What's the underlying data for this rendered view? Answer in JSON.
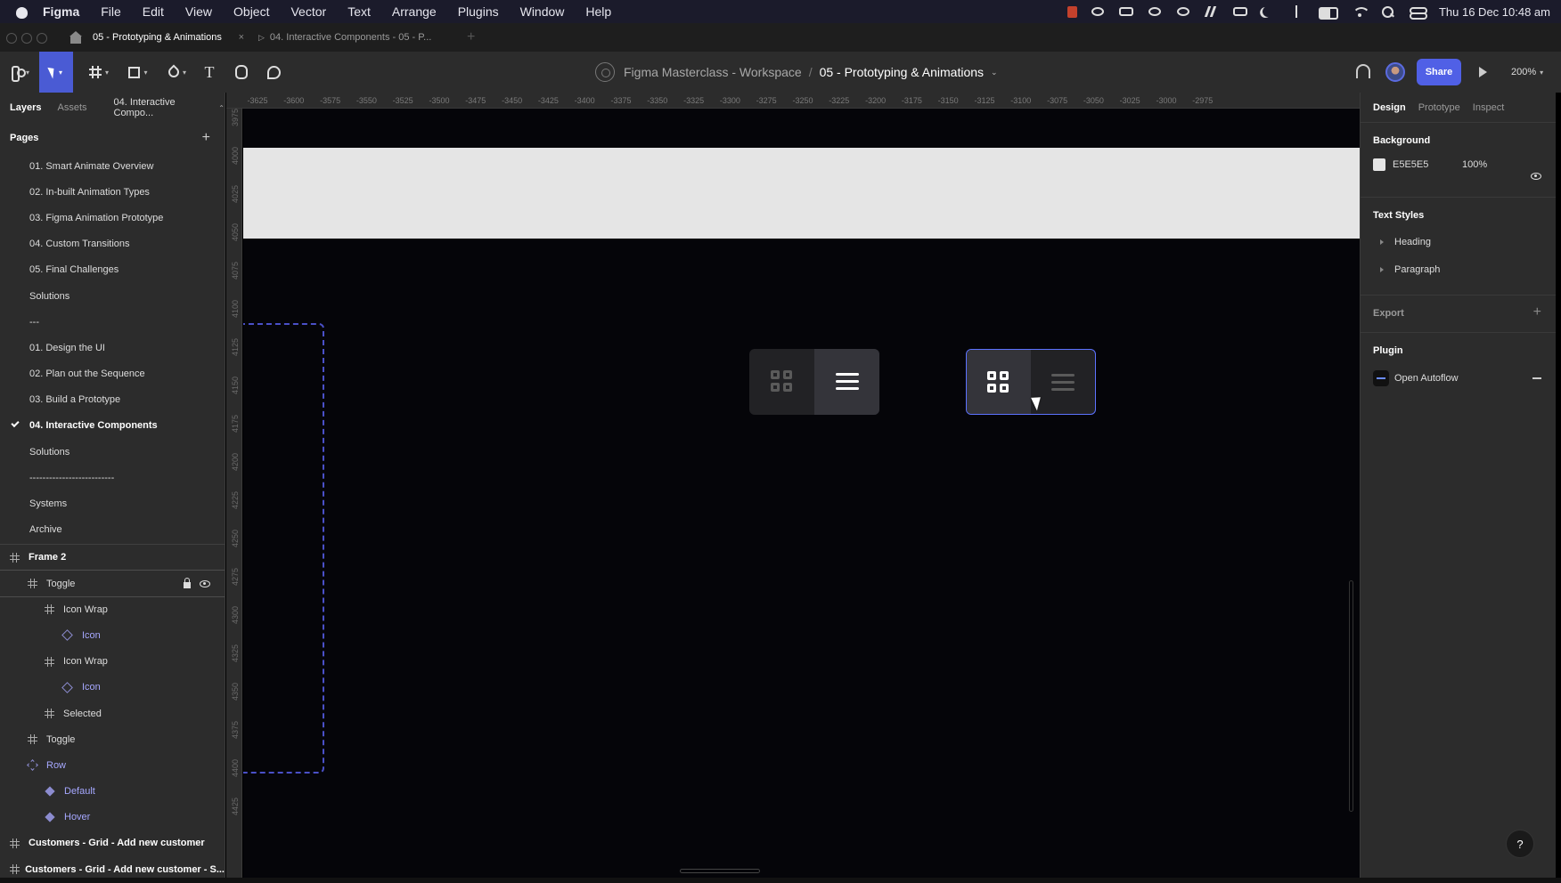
{
  "menubar": {
    "app_name": "Figma",
    "items": [
      "File",
      "Edit",
      "View",
      "Object",
      "Vector",
      "Text",
      "Arrange",
      "Plugins",
      "Window",
      "Help"
    ],
    "clock": "Thu 16 Dec  10:48 am",
    "status_icons": [
      "record-icon",
      "gear-icon",
      "screen-mirror-icon",
      "cloud-icon",
      "circle-icon",
      "bars-icon",
      "shield-icon",
      "moon-icon",
      "bluetooth-icon",
      "battery-icon",
      "wifi-icon",
      "spotlight-search-icon",
      "control-center-icon"
    ]
  },
  "tabs": {
    "active": "05 - Prototyping & Animations",
    "close_glyph": "×",
    "play_glyph": "▷",
    "inactive": "04. Interactive Components - 05 - P...",
    "new_tab_glyph": "+"
  },
  "toolbar": {
    "workspace": "Figma Masterclass - Workspace",
    "separator": "/",
    "file_name": "05 - Prototyping & Animations",
    "caret_glyph": "⌄",
    "share_label": "Share",
    "zoom": "200%",
    "text_tool_glyph": "T",
    "tool_caret": "▾",
    "accent_color": "#4a5bd4"
  },
  "left_panel": {
    "tab_layers": "Layers",
    "tab_assets": "Assets",
    "page_picker": "04. Interactive Compo...",
    "pages_title": "Pages",
    "add_glyph": "+",
    "pages": [
      {
        "label": "01. Smart Animate Overview"
      },
      {
        "label": "02. In-built Animation Types"
      },
      {
        "label": "03. Figma Animation Prototype"
      },
      {
        "label": "04. Custom Transitions"
      },
      {
        "label": "05. Final Challenges"
      },
      {
        "label": "Solutions"
      },
      {
        "label": "---"
      },
      {
        "label": "01. Design the UI"
      },
      {
        "label": "02. Plan out the Sequence"
      },
      {
        "label": "03. Build a Prototype"
      },
      {
        "label": "04. Interactive Components",
        "current": true
      },
      {
        "label": "Solutions"
      },
      {
        "label": "--------------------------"
      },
      {
        "label": "Systems"
      },
      {
        "label": "Archive"
      }
    ],
    "layers": [
      {
        "label": "Frame 2",
        "indent": 0,
        "type": "frame",
        "bold": true
      },
      {
        "label": "Toggle",
        "indent": 1,
        "type": "frame",
        "selected": true
      },
      {
        "label": "Icon Wrap",
        "indent": 2,
        "type": "frame"
      },
      {
        "label": "Icon",
        "indent": 3,
        "type": "instance"
      },
      {
        "label": "Icon Wrap",
        "indent": 2,
        "type": "frame"
      },
      {
        "label": "Icon",
        "indent": 3,
        "type": "instance"
      },
      {
        "label": "Selected",
        "indent": 2,
        "type": "frame"
      },
      {
        "label": "Toggle",
        "indent": 1,
        "type": "frame"
      },
      {
        "label": "Row",
        "indent": 1,
        "type": "component-set"
      },
      {
        "label": "Default",
        "indent": 2,
        "type": "variant"
      },
      {
        "label": "Hover",
        "indent": 2,
        "type": "variant"
      },
      {
        "label": "Customers - Grid - Add new customer",
        "indent": 0,
        "type": "frame",
        "bold": true
      },
      {
        "label": "Customers - Grid - Add new customer - S...",
        "indent": 0,
        "type": "frame",
        "bold": true
      }
    ]
  },
  "ruler": {
    "top": [
      "-3625",
      "-3600",
      "-3575",
      "-3550",
      "-3525",
      "-3500",
      "-3475",
      "-3450",
      "-3425",
      "-3400",
      "-3375",
      "-3350",
      "-3325",
      "-3300",
      "-3275",
      "-3250",
      "-3225",
      "-3200",
      "-3175",
      "-3150",
      "-3125",
      "-3100",
      "-3075",
      "-3050",
      "-3025",
      "-3000",
      "-2975"
    ],
    "left": [
      "3975",
      "4000",
      "4025",
      "4050",
      "4075",
      "4100",
      "4125",
      "4150",
      "4175",
      "4200",
      "4225",
      "4250",
      "4275",
      "4300",
      "4325",
      "4350",
      "4375",
      "4400",
      "4425"
    ]
  },
  "canvas": {
    "background_color": "#050509",
    "band_color": "#e5e5e5",
    "component_stroke": "#4a50c8",
    "selection_color": "#5c72ff"
  },
  "right_panel": {
    "tab_design": "Design",
    "tab_prototype": "Prototype",
    "tab_inspect": "Inspect",
    "background_title": "Background",
    "background_hex": "E5E5E5",
    "background_opacity": "100%",
    "text_styles_title": "Text Styles",
    "text_styles": [
      "Heading",
      "Paragraph"
    ],
    "export_title": "Export",
    "plugin_title": "Plugin",
    "plugin_name": "Open Autoflow",
    "add_glyph": "+",
    "help_glyph": "?"
  }
}
